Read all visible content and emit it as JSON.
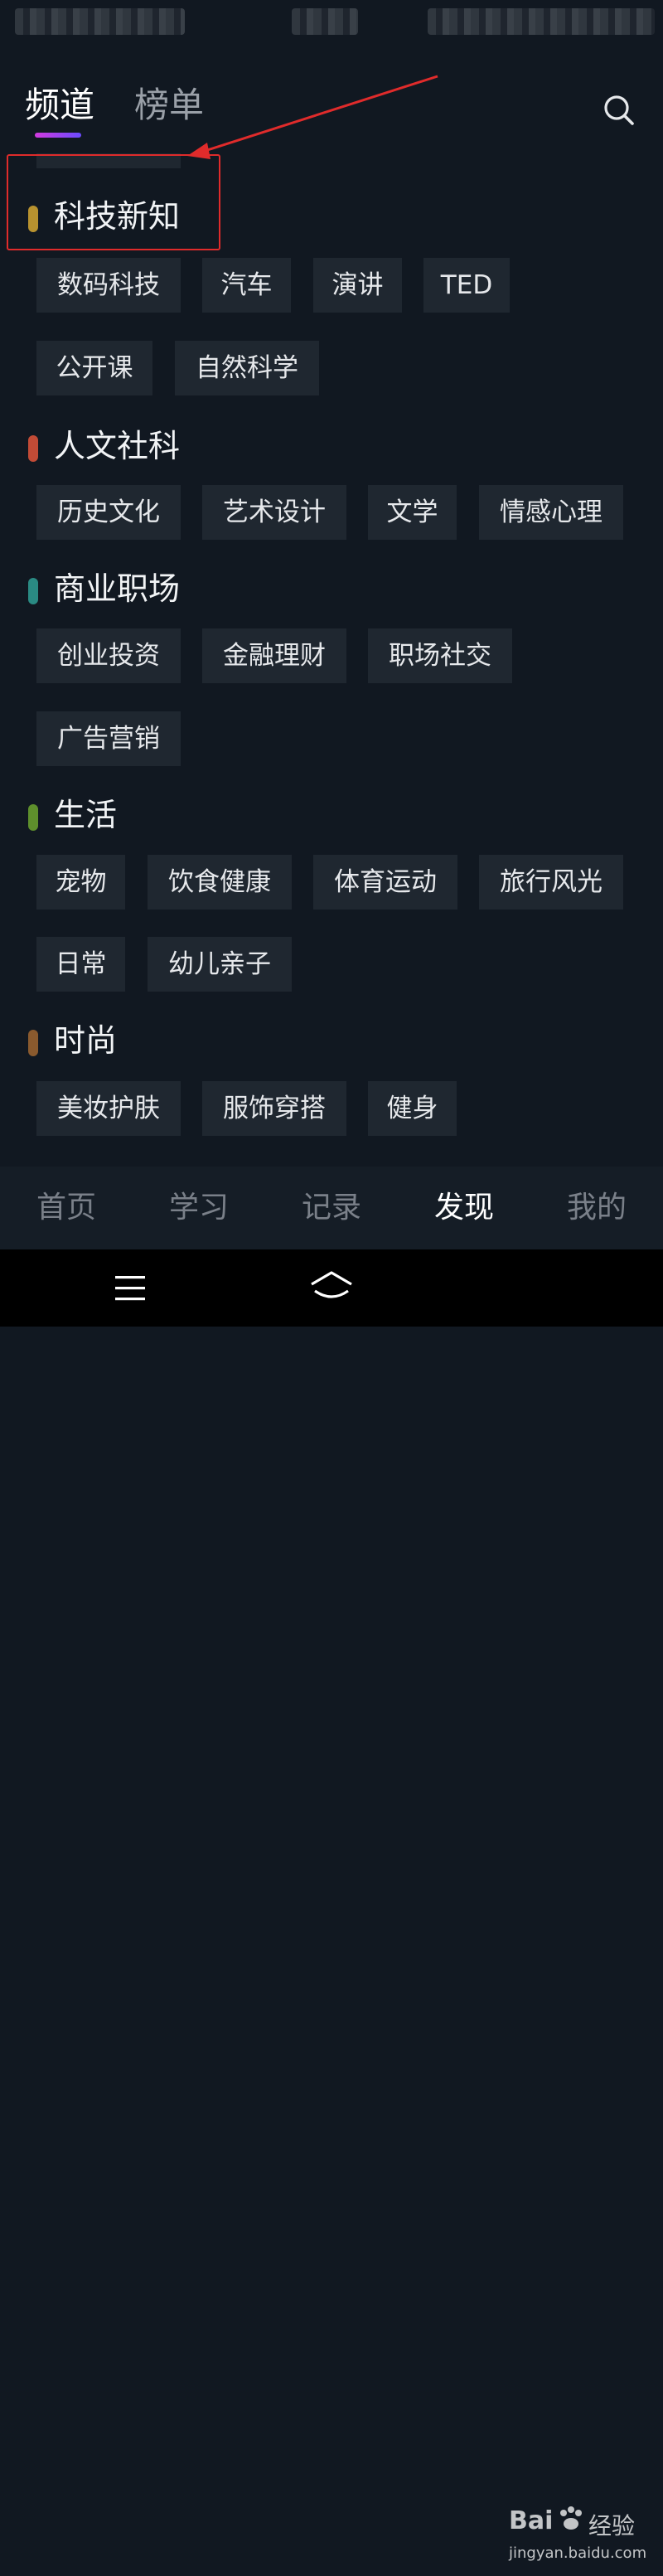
{
  "header": {
    "tabs": [
      {
        "label": "频道"
      },
      {
        "label": "榜单"
      }
    ]
  },
  "sections": [
    {
      "title": "科技新知",
      "color": "#b8922f",
      "items": [
        "数码科技",
        "汽车",
        "演讲",
        "TED",
        "公开课",
        "自然科学"
      ]
    },
    {
      "title": "人文社科",
      "color": "#c24b36",
      "items": [
        "历史文化",
        "艺术设计",
        "文学",
        "情感心理"
      ]
    },
    {
      "title": "商业职场",
      "color": "#2a8a83",
      "items": [
        "创业投资",
        "金融理财",
        "职场社交",
        "广告营销"
      ]
    },
    {
      "title": "生活",
      "color": "#5e8f2c",
      "items": [
        "宠物",
        "饮食健康",
        "体育运动",
        "旅行风光",
        "日常",
        "幼儿亲子"
      ]
    },
    {
      "title": "时尚",
      "color": "#8a5a2e",
      "items": [
        "美妆护肤",
        "服饰穿搭",
        "健身"
      ]
    }
  ],
  "bottom_nav": [
    {
      "label": "首页"
    },
    {
      "label": "学习"
    },
    {
      "label": "记录"
    },
    {
      "label": "发现",
      "active": true
    },
    {
      "label": "我的"
    }
  ],
  "watermark": {
    "brand": "Bai",
    "brand2": "经验",
    "url": "jingyan.baidu.com"
  }
}
